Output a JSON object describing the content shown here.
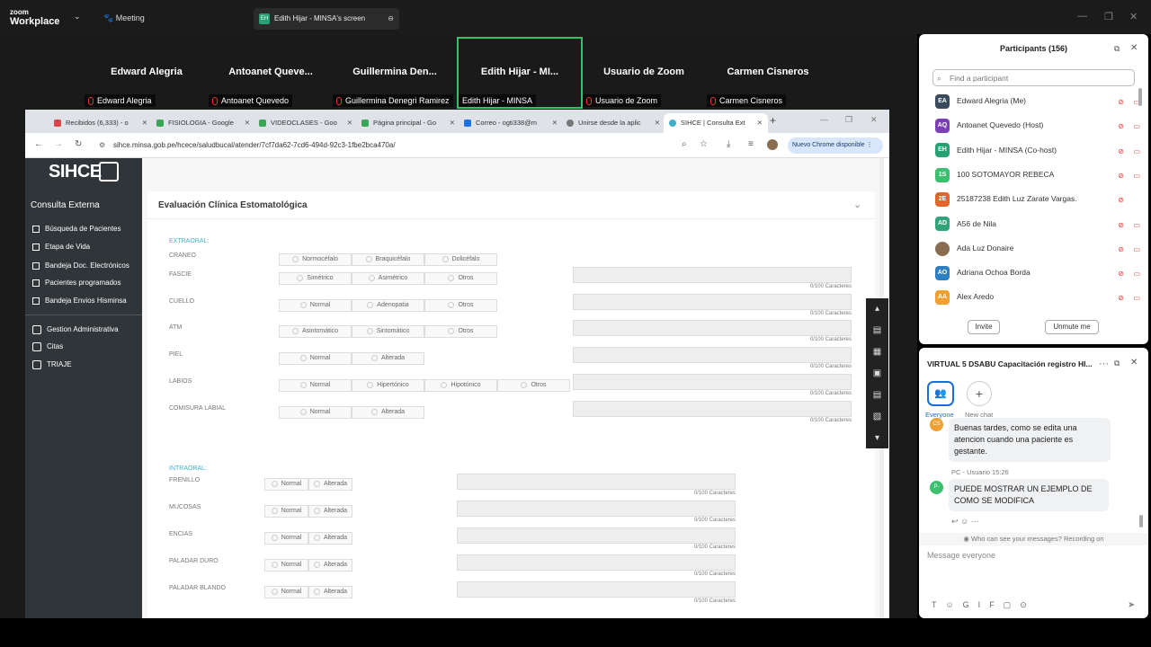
{
  "zoom": {
    "logo_small": "zoom",
    "logo_big": "Workplace",
    "meeting": "Meeting",
    "screen_tab": "Edith Hijar - MINSA's screen"
  },
  "gallery": [
    {
      "name": "Edward Alegria",
      "label": "Edward Alegria"
    },
    {
      "name": "Antoanet  Queve...",
      "label": "Antoanet Quevedo"
    },
    {
      "name": "Guillermina  Den...",
      "label": "Guillermina Denegri Ramirez"
    },
    {
      "name": "Edith Hijar - MI...",
      "label": "Edith Hijar - MINSA"
    },
    {
      "name": "Usuario de Zoom",
      "label": "Usuario de Zoom"
    },
    {
      "name": "Carmen Cisneros",
      "label": "Carmen Cisneros"
    }
  ],
  "browser": {
    "tabs": [
      "Recibidos (6,333) - o",
      "FISIOLOGIA - Google",
      "VIDEOCLASES - Goo",
      "Página principal - Go",
      "Correo - ogti338@m",
      "Unirse desde la aplic",
      "SIHCE | Consulta Ext"
    ],
    "url": "sihce.minsa.gob.pe/hcece/saludbucal/atender/7cf7da62-7cd6-494d-92c3-1fbe2bca470a/",
    "update": "Nuevo Chrome disponible"
  },
  "app": {
    "logo": "SIHCE",
    "section": "Consulta Externa",
    "menu": [
      "Búsqueda de Pacientes",
      "Etapa de Vida",
      "Bandeja Doc. Electrónicos",
      "Pacientes programados",
      "Bandeja Envios Hisminsa"
    ],
    "menu2": [
      "Gestion Administrativa",
      "Citas",
      "TRIAJE"
    ],
    "card_title": "Evaluación Clínica Estomatológica",
    "extraoral": "EXTRAORAL:",
    "intraoral": "INTRAORAL:",
    "counter": "0/100 Caracteres",
    "ext_rows": [
      {
        "label": "CRANEO",
        "options": [
          "Normocéfalo",
          "Braquicéfalo",
          "Dolicéfalo"
        ]
      },
      {
        "label": "FASCIE",
        "options": [
          "Simétrico",
          "Asimétrico",
          "Otros"
        ]
      },
      {
        "label": "CUELLO",
        "options": [
          "Normal",
          "Adenopatia",
          "Otros"
        ]
      },
      {
        "label": "ATM",
        "options": [
          "Asintomático",
          "Sintomático",
          "Otros"
        ]
      },
      {
        "label": "PIEL",
        "options": [
          "Normal",
          "Alterada"
        ]
      },
      {
        "label": "LABIOS",
        "options": [
          "Normal",
          "Hipertónico",
          "Hipotónico",
          "Otros"
        ]
      },
      {
        "label": "COMISURA LABIAL",
        "options": [
          "Normal",
          "Alterada"
        ]
      }
    ],
    "int_rows": [
      {
        "label": "FRENILLO",
        "options": [
          "Normal",
          "Alterada"
        ]
      },
      {
        "label": "MUCOSAS",
        "options": [
          "Normal",
          "Alterada"
        ]
      },
      {
        "label": "ENCIAS",
        "options": [
          "Normal",
          "Alterada"
        ]
      },
      {
        "label": "PALADAR DURO",
        "options": [
          "Normal",
          "Alterada"
        ]
      },
      {
        "label": "PALADAR BLANDO",
        "options": [
          "Normal",
          "Alterada"
        ]
      }
    ]
  },
  "participants": {
    "title": "Participants (156)",
    "search_placeholder": "Find a participant",
    "list": [
      {
        "initials": "EA",
        "name": "Edward Alegria (Me)",
        "color": "#3a4a5c"
      },
      {
        "initials": "AQ",
        "name": "Antoanet Quevedo (Host)",
        "color": "#7b3fb8"
      },
      {
        "initials": "EH",
        "name": "Edith Hijar - MINSA (Co-host)",
        "color": "#25a174"
      },
      {
        "initials": "1S",
        "name": "100 SOTOMAYOR REBECA",
        "color": "#3cbf6e"
      },
      {
        "initials": "2E",
        "name": "25187238 Edith Luz Zarate Vargas.",
        "color": "#e2652a"
      },
      {
        "initials": "AD",
        "name": "A56 de Nila",
        "color": "#2fa37a"
      },
      {
        "initials": "",
        "name": "Ada Luz  Donaire",
        "color": "#8a6d50"
      },
      {
        "initials": "AO",
        "name": "Adriana Ochoa Borda",
        "color": "#2d7fc1"
      },
      {
        "initials": "AA",
        "name": "Alex Aredo",
        "color": "#f0a030"
      }
    ],
    "invite": "Invite",
    "unmute": "Unmute me"
  },
  "chat": {
    "title": "VIRTUAL 5 DSABU Capacitación registro HI...",
    "everyone": "Everyone",
    "new_chat": "New chat",
    "msg1": "Buenas tardes, como se edita una atencion cuando una paciente es gestante.",
    "msg1_avatar": "CS",
    "sender2": "PC - Usuario 15:26",
    "msg2_avatar": "P-",
    "msg2": "PUEDE MOSTRAR UN EJEMPLO DE COMO SE MODIFICA",
    "privacy": "Who can see your messages? Recording on",
    "input_placeholder": "Message everyone"
  }
}
